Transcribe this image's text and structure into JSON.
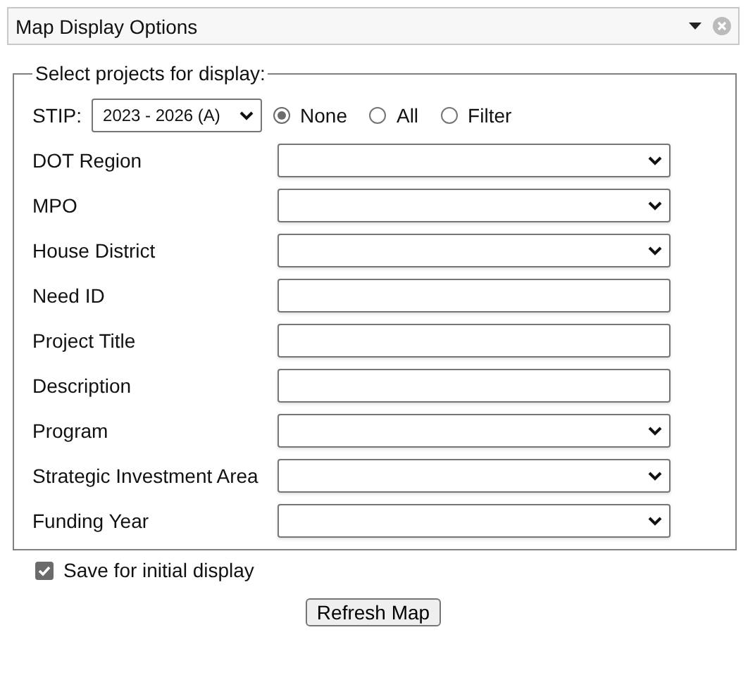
{
  "panel": {
    "title": "Map Display Options"
  },
  "fieldset": {
    "legend": "Select projects for display:"
  },
  "stip": {
    "label": "STIP:",
    "value": "2023 - 2026 (A)",
    "options": [
      {
        "label": "None",
        "selected": true
      },
      {
        "label": "All",
        "selected": false
      },
      {
        "label": "Filter",
        "selected": false
      }
    ]
  },
  "fields": [
    {
      "label": "DOT Region",
      "kind": "select"
    },
    {
      "label": "MPO",
      "kind": "select"
    },
    {
      "label": "House District",
      "kind": "select"
    },
    {
      "label": "Need ID",
      "kind": "text"
    },
    {
      "label": "Project Title",
      "kind": "text"
    },
    {
      "label": "Description",
      "kind": "text"
    },
    {
      "label": "Program",
      "kind": "select"
    },
    {
      "label": "Strategic Investment Area",
      "kind": "select"
    },
    {
      "label": "Funding Year",
      "kind": "select"
    }
  ],
  "save": {
    "label": "Save for initial display",
    "checked": true
  },
  "buttons": [
    "Refresh Map"
  ]
}
